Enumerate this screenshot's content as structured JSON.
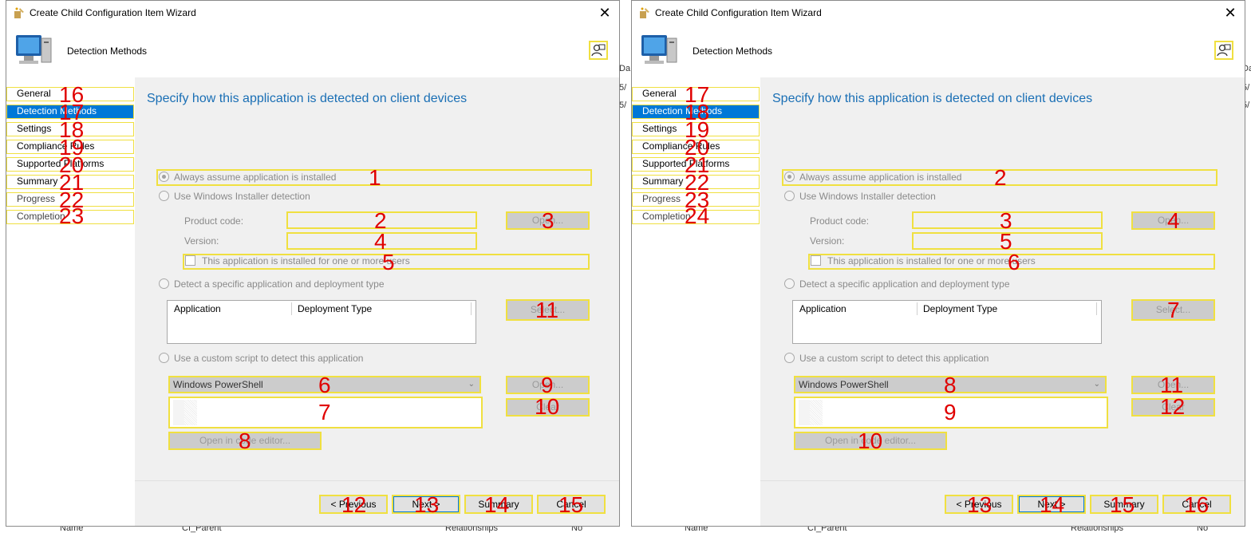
{
  "background": {
    "fragments": [
      "Da",
      "5/",
      "5/",
      "Name",
      "CI_Parent",
      "Relationships",
      "No"
    ]
  },
  "wizards": [
    {
      "title": "Create Child Configuration Item Wizard",
      "close_symbol": "✕",
      "header_title": "Detection Methods",
      "nav": [
        {
          "label": "General",
          "marker": "16"
        },
        {
          "label": "Detection Methods",
          "marker": "17"
        },
        {
          "label": "Settings",
          "marker": "18"
        },
        {
          "label": "Compliance Rules",
          "marker": "19"
        },
        {
          "label": "Supported Platforms",
          "marker": "20"
        },
        {
          "label": "Summary",
          "marker": "21"
        },
        {
          "label": "Progress",
          "marker": "22"
        },
        {
          "label": "Completion",
          "marker": "23"
        }
      ],
      "heading": "Specify how this application is detected on client devices",
      "radio_always": "Always assume application is installed",
      "radio_msi": "Use Windows Installer detection",
      "product_code_label": "Product code:",
      "version_label": "Version:",
      "open_label": "Open...",
      "installed_for_users": "This application is installed for one or more users",
      "radio_specific": "Detect a specific application and deployment type",
      "col_application": "Application",
      "col_deployment_type": "Deployment Type",
      "select_label": "Select...",
      "radio_script": "Use a custom script to detect this application",
      "script_type": "Windows PowerShell",
      "script_open_label": "Open...",
      "clear_label": "Clear",
      "code_editor_label": "Open in code editor...",
      "previous_label": "< Previous",
      "next_label": "Next >",
      "summary_label": "Summary",
      "cancel_label": "Cancel",
      "markers": {
        "always": "1",
        "product_code": "2",
        "open": "3",
        "version": "4",
        "users": "5",
        "dropdown": "6",
        "script": "7",
        "editor": "8",
        "script_open": "9",
        "clear": "10",
        "select": "11",
        "previous": "12",
        "next": "13",
        "summary": "14",
        "cancel": "15"
      }
    },
    {
      "title": "Create Child Configuration Item Wizard",
      "close_symbol": "✕",
      "header_title": "Detection Methods",
      "nav": [
        {
          "label": "General",
          "marker": "17"
        },
        {
          "label": "Detection Methods",
          "marker": "18"
        },
        {
          "label": "Settings",
          "marker": "19"
        },
        {
          "label": "Compliance Rules",
          "marker": "20"
        },
        {
          "label": "Supported Platforms",
          "marker": "21"
        },
        {
          "label": "Summary",
          "marker": "22"
        },
        {
          "label": "Progress",
          "marker": "23"
        },
        {
          "label": "Completion",
          "marker": "24"
        }
      ],
      "heading": "Specify how this application is detected on client devices",
      "radio_always": "Always assume application is installed",
      "radio_msi": "Use Windows Installer detection",
      "product_code_label": "Product code:",
      "version_label": "Version:",
      "open_label": "Open...",
      "installed_for_users": "This application is installed for one or more users",
      "radio_specific": "Detect a specific application and deployment type",
      "col_application": "Application",
      "col_deployment_type": "Deployment Type",
      "select_label": "Select...",
      "radio_script": "Use a custom script to detect this application",
      "script_type": "Windows PowerShell",
      "script_open_label": "Open...",
      "clear_label": "Clear",
      "code_editor_label": "Open in code editor...",
      "previous_label": "< Previous",
      "next_label": "Next >",
      "summary_label": "Summary",
      "cancel_label": "Cancel",
      "markers": {
        "always": "2",
        "product_code": "3",
        "open": "4",
        "version": "5",
        "users": "6",
        "dropdown": "8",
        "script": "9",
        "editor": "10",
        "script_open": "11",
        "clear": "12",
        "select": "7",
        "previous": "13",
        "next": "14",
        "summary": "15",
        "cancel": "16"
      }
    }
  ]
}
